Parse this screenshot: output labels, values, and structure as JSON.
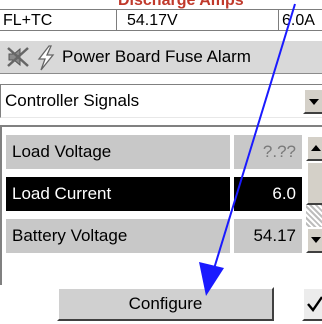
{
  "callout": {
    "text": "Discharge Amps"
  },
  "status_bar": {
    "mode": "FL+TC",
    "voltage": "54.17V",
    "amps": "6.0A"
  },
  "alarm_bar": {
    "text": "Power Board Fuse Alarm",
    "mute_icon": "muted-speaker-icon",
    "bolt_icon": "lightning-bolt-icon"
  },
  "dropdown": {
    "value": "Controller Signals",
    "arrow_icon": "chevron-down-icon"
  },
  "signals": [
    {
      "name": "Load Voltage",
      "value": "?.??",
      "selected": false
    },
    {
      "name": "Load Current",
      "value": "6.0",
      "selected": true
    },
    {
      "name": "Battery Voltage",
      "value": "54.17",
      "selected": false
    }
  ],
  "scrollbar": {
    "up_icon": "arrow-up-icon",
    "down_icon": "arrow-down-icon"
  },
  "configure_button": {
    "label": "Configure"
  },
  "ok_button": {
    "icon": "checkmark-icon"
  },
  "annotation": {
    "color": "#1a1aff",
    "icon": "annotation-arrow"
  },
  "colors": {
    "callout": "#c0392b",
    "selected_row": "#000000",
    "row_bg": "#c8c8c8"
  }
}
